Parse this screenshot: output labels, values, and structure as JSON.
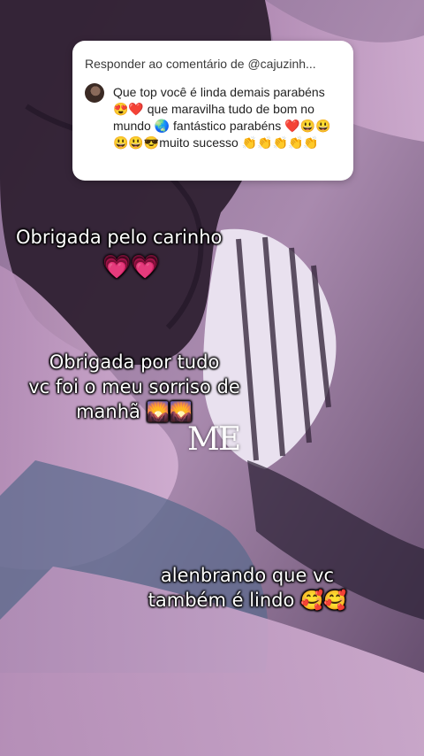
{
  "reply": {
    "header": "Responder ao comentário de @cajuzinh...",
    "comment": "Que top você é linda demais parabéns 😍❤️ que maravilha tudo de bom no mundo 🌏 fantástico parabéns ❤️😃😃😃😃😎muito sucesso 👏👏👏👏👏"
  },
  "captions": {
    "line1": "Obrigada pelo carinho",
    "line1_hearts": "💗💗",
    "line2": "Obrigada por tudo\nvc foi o meu sorriso de\nmanhã 🌄🌄",
    "line3": "alenbrando que vc\ntambém é lindo 🥰🥰"
  },
  "watermark": "ME"
}
